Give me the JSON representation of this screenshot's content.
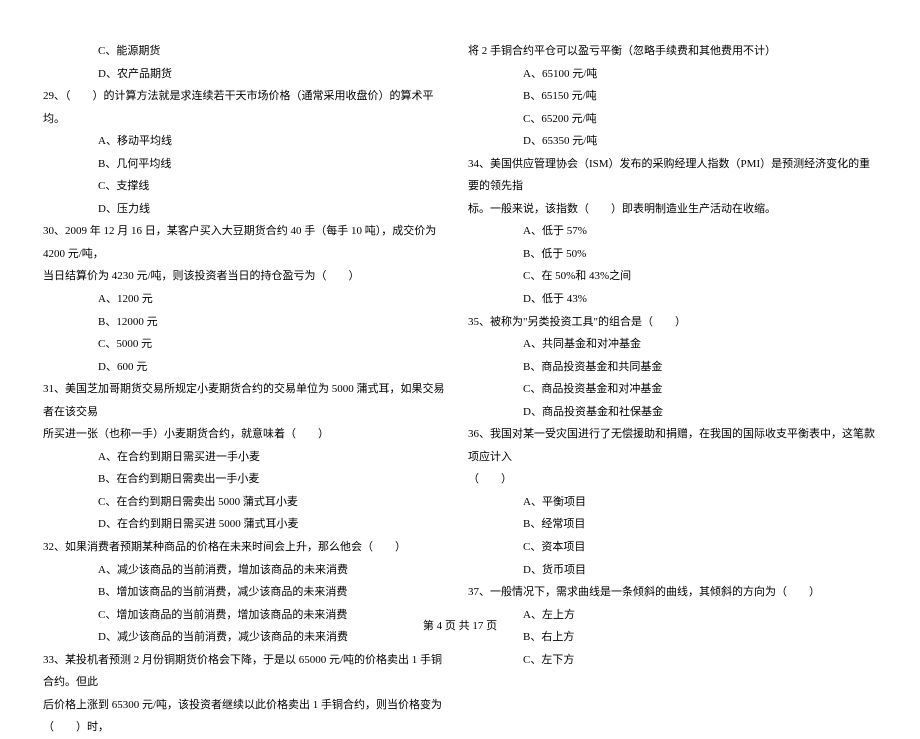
{
  "left": {
    "q28_c": "C、能源期货",
    "q28_d": "D、农产品期货",
    "q29": "29、（　　）的计算方法就是求连续若干天市场价格（通常采用收盘价）的算术平均。",
    "q29_a": "A、移动平均线",
    "q29_b": "B、几何平均线",
    "q29_c": "C、支撑线",
    "q29_d": "D、压力线",
    "q30_1": "30、2009 年 12 月 16 日，某客户买入大豆期货合约 40 手（每手 10 吨），成交价为 4200 元/吨，",
    "q30_2": "当日结算价为 4230 元/吨，则该投资者当日的持仓盈亏为（　　）",
    "q30_a": "A、1200 元",
    "q30_b": "B、12000 元",
    "q30_c": "C、5000 元",
    "q30_d": "D、600 元",
    "q31_1": "31、美国芝加哥期货交易所规定小麦期货合约的交易单位为 5000 蒲式耳，如果交易者在该交易",
    "q31_2": "所买进一张（也称一手）小麦期货合约，就意味着（　　）",
    "q31_a": "A、在合约到期日需买进一手小麦",
    "q31_b": "B、在合约到期日需卖出一手小麦",
    "q31_c": "C、在合约到期日需卖出 5000 蒲式耳小麦",
    "q31_d": "D、在合约到期日需买进 5000 蒲式耳小麦",
    "q32": "32、如果消费者预期某种商品的价格在未来时间会上升，那么他会（　　）",
    "q32_a": "A、减少该商品的当前消费，增加该商品的未来消费",
    "q32_b": "B、增加该商品的当前消费，减少该商品的未来消费",
    "q32_c": "C、增加该商品的当前消费，增加该商品的未来消费",
    "q32_d": "D、减少该商品的当前消费，减少该商品的未来消费",
    "q33_1": "33、某投机者预测 2 月份铜期货价格会下降，于是以 65000 元/吨的价格卖出 1 手铜合约。但此",
    "q33_2": "后价格上涨到 65300 元/吨，该投资者继续以此价格卖出 1 手铜合约，则当价格变为（　　）时，"
  },
  "right": {
    "q33_3": "将 2 手铜合约平仓可以盈亏平衡（忽略手续费和其他费用不计）",
    "q33_a": "A、65100 元/吨",
    "q33_b": "B、65150 元/吨",
    "q33_c": "C、65200 元/吨",
    "q33_d": "D、65350 元/吨",
    "q34_1": "34、美国供应管理协会（ISM）发布的采购经理人指数（PMI）是预测经济变化的重要的领先指",
    "q34_2": "标。一般来说，该指数（　　）即表明制造业生产活动在收缩。",
    "q34_a": "A、低于 57%",
    "q34_b": "B、低于 50%",
    "q34_c": "C、在 50%和 43%之间",
    "q34_d": "D、低于 43%",
    "q35": "35、被称为\"另类投资工具\"的组合是（　　）",
    "q35_a": "A、共同基金和对冲基金",
    "q35_b": "B、商品投资基金和共同基金",
    "q35_c": "C、商品投资基金和对冲基金",
    "q35_d": "D、商品投资基金和社保基金",
    "q36_1": "36、我国对某一受灾国进行了无偿援助和捐赠，在我国的国际收支平衡表中，这笔款项应计入",
    "q36_2": "（　　）",
    "q36_a": "A、平衡项目",
    "q36_b": "B、经常项目",
    "q36_c": "C、资本项目",
    "q36_d": "D、货币项目",
    "q37": "37、一般情况下，需求曲线是一条倾斜的曲线，其倾斜的方向为（　　）",
    "q37_a": "A、左上方",
    "q37_b": "B、右上方",
    "q37_c": "C、左下方"
  },
  "footer": "第 4 页 共 17 页"
}
